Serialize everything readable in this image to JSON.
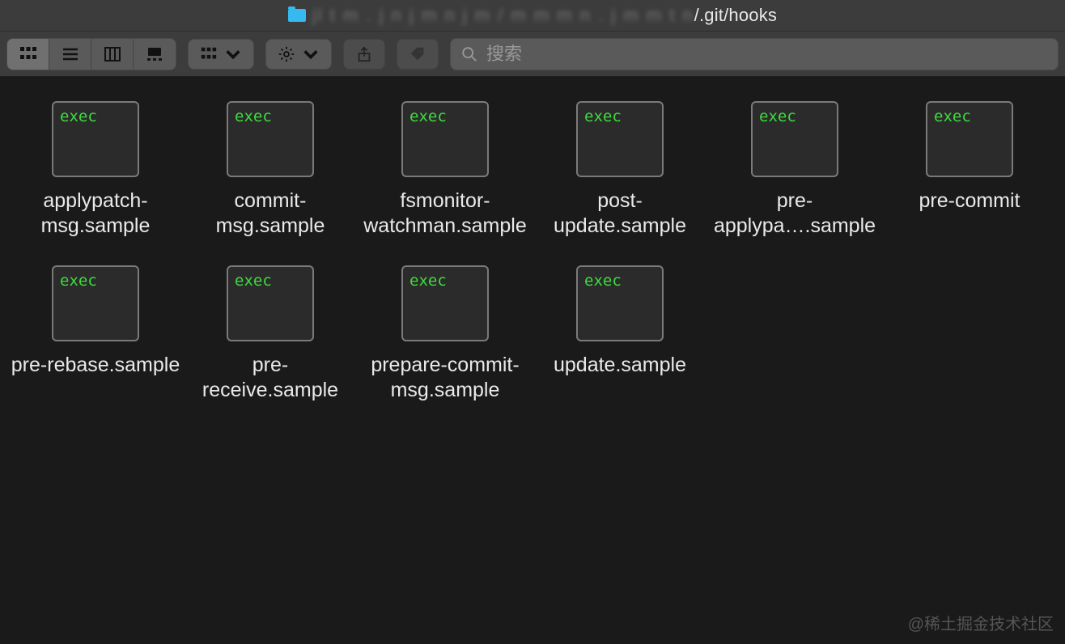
{
  "titlebar": {
    "path_visible_suffix": "/.git/hooks"
  },
  "search": {
    "placeholder": "搜索",
    "value": ""
  },
  "file_badge": "exec",
  "files": [
    {
      "name": "applypatch-msg.sample"
    },
    {
      "name": "commit-msg.sample"
    },
    {
      "name": "fsmonitor-watchman.sample"
    },
    {
      "name": "post-update.sample"
    },
    {
      "name": "pre-applypa….sample"
    },
    {
      "name": "pre-commit"
    },
    {
      "name": "pre-rebase.sample"
    },
    {
      "name": "pre-receive.sample"
    },
    {
      "name": "prepare-commit-msg.sample"
    },
    {
      "name": "update.sample"
    }
  ],
  "watermark": "@稀土掘金技术社区"
}
